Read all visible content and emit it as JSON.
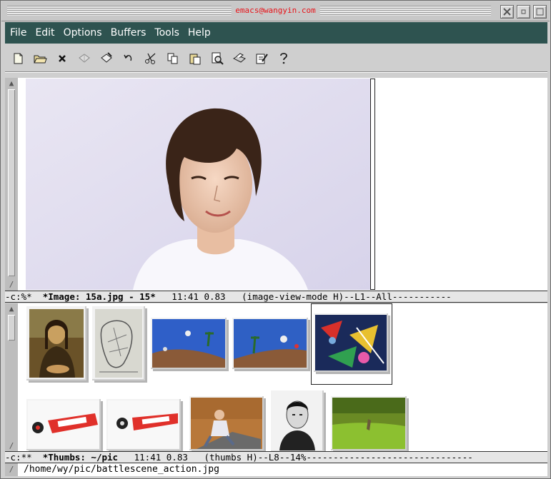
{
  "window": {
    "title": "emacs@wangyin.com",
    "buttons": [
      "close",
      "minimize",
      "maximize"
    ]
  },
  "menubar": {
    "items": [
      "File",
      "Edit",
      "Options",
      "Buffers",
      "Tools",
      "Help"
    ]
  },
  "toolbar": {
    "icons": [
      "open-file-icon",
      "open-directory-icon",
      "close-buffer-icon",
      "save-icon",
      "save-as-icon",
      "undo-icon",
      "cut-icon",
      "copy-icon",
      "paste-icon",
      "search-icon",
      "print-icon",
      "customize-icon",
      "help-icon"
    ]
  },
  "upper_buffer": {
    "image_name": "15a.jpg"
  },
  "modeline_upper": {
    "prefix": "-c:%*  ",
    "buffer": "*Image: 15a.jpg - 15*",
    "rest": "   11:41 0.83   (image-view-mode H)--L1--All-----------"
  },
  "lower_buffer": {
    "thumbnails": [
      {
        "name": "mona-lisa"
      },
      {
        "name": "sketch"
      },
      {
        "name": "skate-ramp-1"
      },
      {
        "name": "skate-ramp-2"
      },
      {
        "name": "battlescene-action"
      },
      {
        "name": "skateboard-red-1"
      },
      {
        "name": "skateboard-red-2"
      },
      {
        "name": "skate-ramp-indoor"
      },
      {
        "name": "portrait-man"
      },
      {
        "name": "grass-field"
      }
    ]
  },
  "modeline_lower": {
    "prefix": "-c:**  ",
    "buffer": "*Thumbs: ~/pic",
    "rest": "   11:41 0.83   (thumbs H)--L8--14%-------------------------------"
  },
  "minibuffer": {
    "text": "/home/wy/pic/battlescene_action.jpg"
  },
  "colors": {
    "menubar_bg": "#2e5350",
    "title_text": "#e8141a"
  }
}
